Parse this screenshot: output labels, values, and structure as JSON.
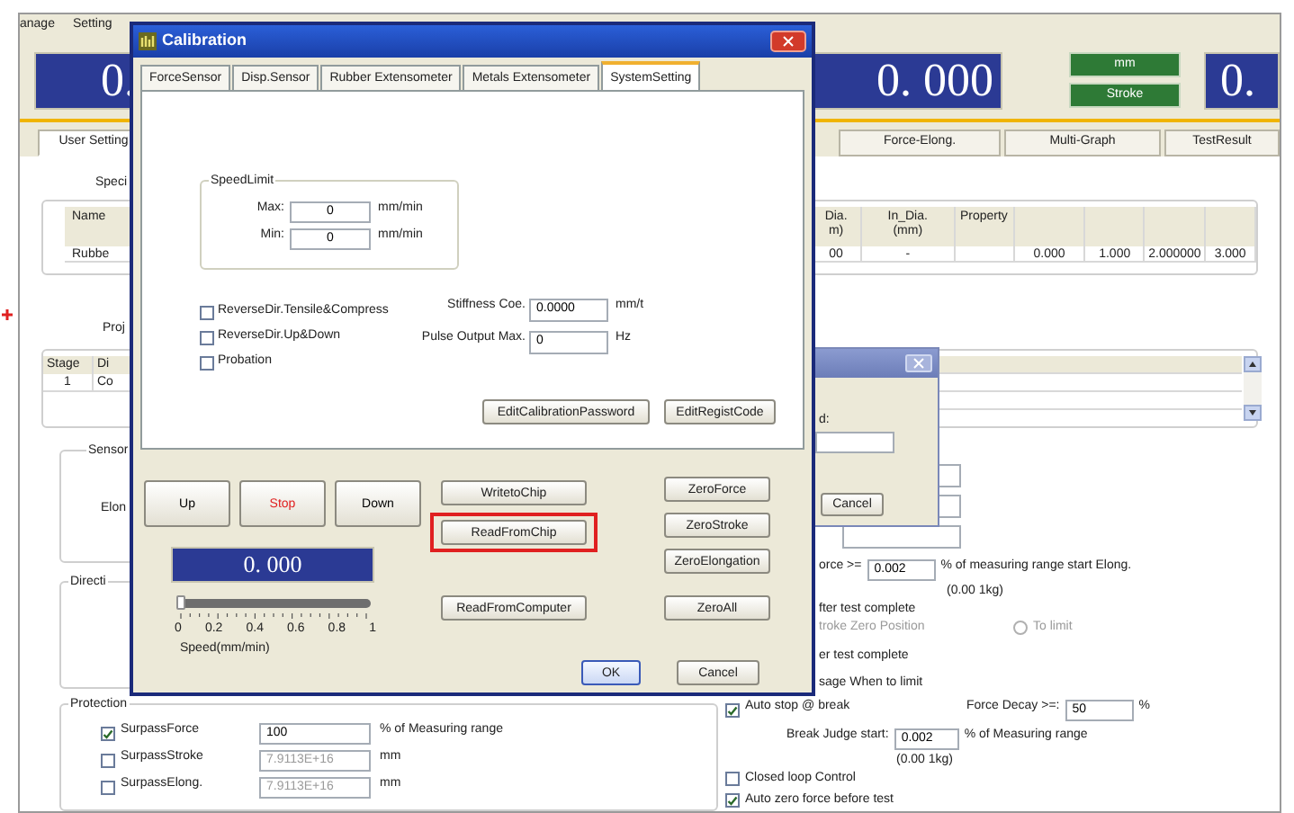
{
  "app": {
    "menu": [
      "anage",
      "Setting"
    ],
    "displays": [
      {
        "value": "0."
      },
      {
        "value": "0. 000"
      },
      {
        "value": "0."
      }
    ],
    "unit_labels": [
      "mm",
      "Stroke"
    ],
    "tabs": [
      {
        "label": "User Setting",
        "selected": true
      },
      {
        "label": "Force-Elong.",
        "selected": false
      },
      {
        "label": "Multi-Graph",
        "selected": false
      },
      {
        "label": "TestResult",
        "selected": false
      }
    ],
    "specimen_label": "Speci",
    "specimen_table": {
      "columns": [
        "Name",
        "Dia.\nm)",
        "In_Dia.\n(mm)",
        "Property"
      ],
      "rows": [
        [
          "Rubbe",
          "00",
          "-",
          null,
          "0.000",
          "1.000",
          "2.000000",
          "3.000"
        ]
      ]
    },
    "project_label": "Proj",
    "stage_table": {
      "columns": [
        "Stage",
        "Di"
      ],
      "rows": [
        [
          "1",
          "Co"
        ]
      ]
    },
    "sensor_group": {
      "title": "Sensor",
      "label": "Elon"
    },
    "direction_group": {
      "title": "Directi"
    },
    "protection": {
      "title": "Protection",
      "items": [
        {
          "label": "SurpassForce",
          "checked": true,
          "value": "100",
          "unit": "% of Measuring range",
          "disabled": false
        },
        {
          "label": "SurpassStroke",
          "checked": false,
          "value": "7.9113E+16",
          "unit": "mm",
          "disabled": true
        },
        {
          "label": "SurpassElong.",
          "checked": false,
          "value": "7.9113E+16",
          "unit": "mm",
          "disabled": true
        }
      ]
    },
    "settings": {
      "start_force": {
        "label": "orce >=",
        "value": "0.002",
        "unit": "% of measuring range start Elong.",
        "note": "(0.00 1kg)"
      },
      "after_test": "fter test complete",
      "stroke_zero": "troke Zero Position",
      "to_limit": {
        "label": "To limit",
        "selected": false
      },
      "after_test_2": "er test complete",
      "message": "sage When to limit",
      "auto_stop": {
        "label": "Auto stop @ break",
        "checked": true
      },
      "force_decay": {
        "label": "Force Decay >=:",
        "value": "50",
        "unit": "%"
      },
      "break_judge": {
        "label": "Break Judge start:",
        "value": "0.002",
        "unit": "% of Measuring range",
        "note": "(0.00 1kg)"
      },
      "closed_loop": {
        "label": "Closed loop Control",
        "checked": false
      },
      "auto_zero": {
        "label": "Auto zero force before test",
        "checked": true
      }
    }
  },
  "back_dialog": {
    "label": "d:",
    "button": "Cancel"
  },
  "calibration": {
    "title": "Calibration",
    "tabs": [
      {
        "label": "ForceSensor",
        "selected": false
      },
      {
        "label": "Disp.Sensor",
        "selected": false
      },
      {
        "label": "Rubber Extensometer",
        "selected": false
      },
      {
        "label": "Metals Extensometer",
        "selected": false
      },
      {
        "label": "SystemSetting",
        "selected": true
      }
    ],
    "speed_limit": {
      "title": "SpeedLimit",
      "fields": [
        {
          "label": "Max:",
          "value": "0",
          "unit": "mm/min"
        },
        {
          "label": "Min:",
          "value": "0",
          "unit": "mm/min"
        }
      ]
    },
    "options": [
      {
        "label": "ReverseDir.Tensile&Compress",
        "checked": false
      },
      {
        "label": "ReverseDir.Up&Down",
        "checked": false
      },
      {
        "label": "Probation",
        "checked": false
      }
    ],
    "params": [
      {
        "label": "Stiffness Coe.",
        "value": "0.0000",
        "unit": "mm/t"
      },
      {
        "label": "Pulse Output Max.",
        "value": "0",
        "unit": "Hz"
      }
    ],
    "panel_buttons": [
      "EditCalibrationPassword",
      "EditRegistCode"
    ],
    "jog_buttons": [
      {
        "label": "Up",
        "kind": "normal"
      },
      {
        "label": "Stop",
        "kind": "stop"
      },
      {
        "label": "Down",
        "kind": "normal"
      }
    ],
    "display": "0. 000",
    "speed": {
      "level": 0,
      "ticks": [
        "0",
        "0.2",
        "0.4",
        "0.6",
        "0.8",
        "1"
      ],
      "label": "Speed(mm/min)"
    },
    "chip_buttons": [
      {
        "label": "WritetoChip",
        "highlighted": false
      },
      {
        "label": "ReadFromChip",
        "highlighted": true
      },
      {
        "label": "ReadFromComputer",
        "highlighted": false
      }
    ],
    "zero_buttons": [
      "ZeroForce",
      "ZeroStroke",
      "ZeroElongation",
      "ZeroAll"
    ],
    "dialog_buttons": [
      {
        "label": "OK",
        "default": true
      },
      {
        "label": "Cancel",
        "default": false
      }
    ]
  }
}
